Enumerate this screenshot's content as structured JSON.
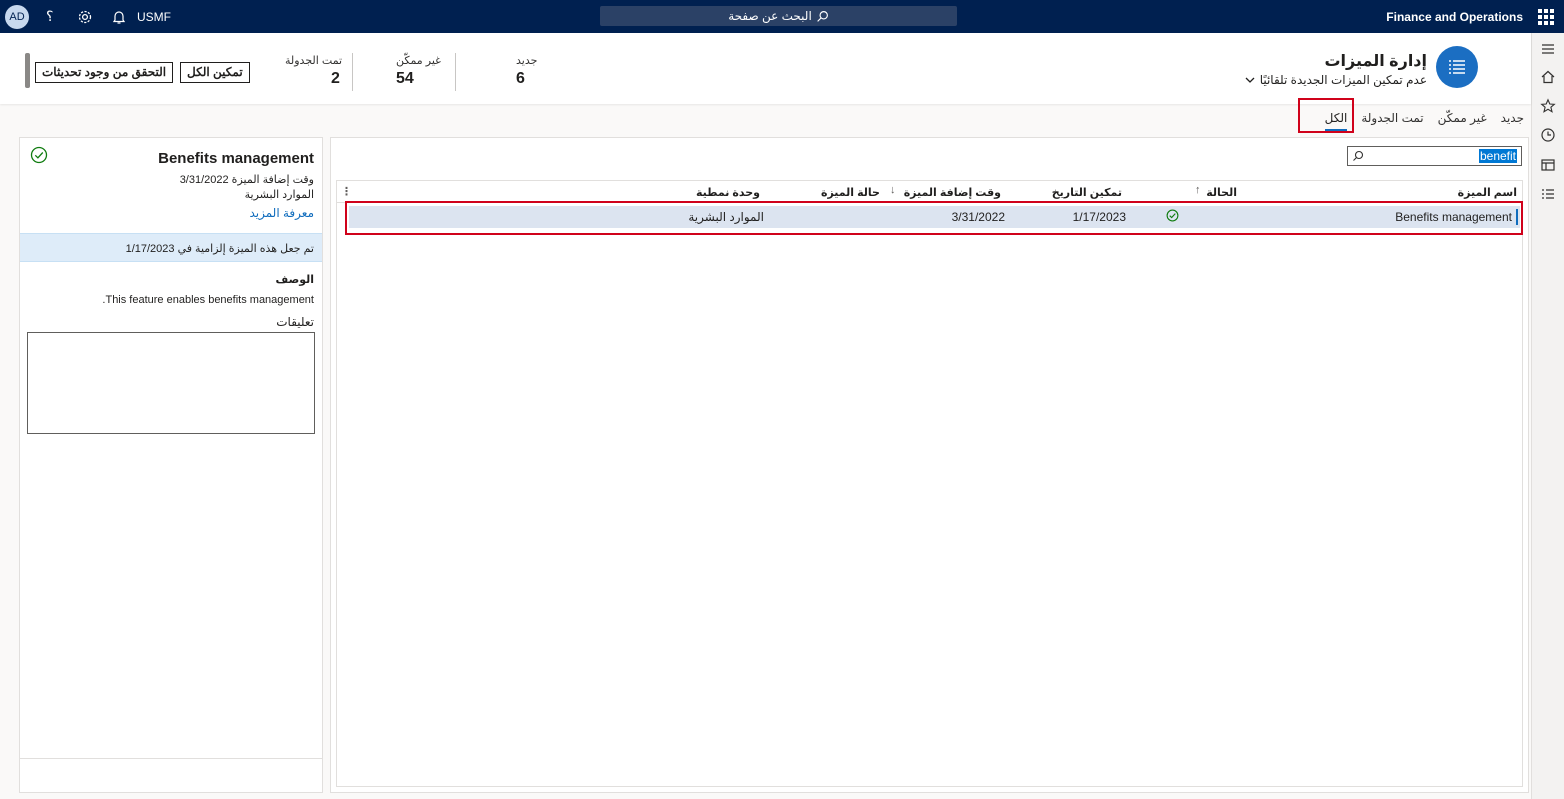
{
  "topbar": {
    "app_name": "Finance and Operations",
    "search_placeholder": "البحث عن صفحة",
    "company": "USMF",
    "avatar": "AD",
    "help": "؟"
  },
  "header": {
    "title": "إدارة الميزات",
    "subtitle": "عدم تمكين الميزات الجديدة تلقائيًا",
    "tiles": {
      "new": {
        "label": "جديد",
        "value": "6"
      },
      "not_enabled": {
        "label": "غير ممكّن",
        "value": "54"
      },
      "scheduled": {
        "label": "تمت الجدولة",
        "value": "2"
      }
    },
    "buttons": {
      "enable_all": "تمكين الكل",
      "check_updates": "التحقق من وجود تحديثات"
    }
  },
  "tabs": [
    "جديد",
    "غير ممكّن",
    "تمت الجدولة",
    "الكل"
  ],
  "filter": {
    "value": "benefit"
  },
  "grid": {
    "columns": [
      "اسم الميزة",
      "الحالة",
      "تمكين التاريخ",
      "وقت إضافة الميزة",
      "حالة الميزة",
      "وحدة نمطية"
    ],
    "rows": [
      {
        "name": "Benefits management",
        "status_icon": "check-circle-icon",
        "enabled_date": "1/17/2023",
        "added": "3/31/2022",
        "feature_state": "",
        "module": "الموارد البشرية"
      }
    ]
  },
  "details": {
    "title": "Benefits management",
    "added_label": "وقت إضافة الميزة 3/31/2022",
    "module": "الموارد البشرية",
    "learn_more": "معرفة المزيد",
    "banner": "تم جعل هذه الميزة إلزامية في 1/17/2023",
    "description_label": "الوصف",
    "description": "This feature enables benefits management.",
    "comments_label": "تعليقات"
  },
  "colors": {
    "nav": "#002050",
    "accent": "#0f6cbd",
    "highlight": "#d0021b",
    "success": "#107c10"
  }
}
